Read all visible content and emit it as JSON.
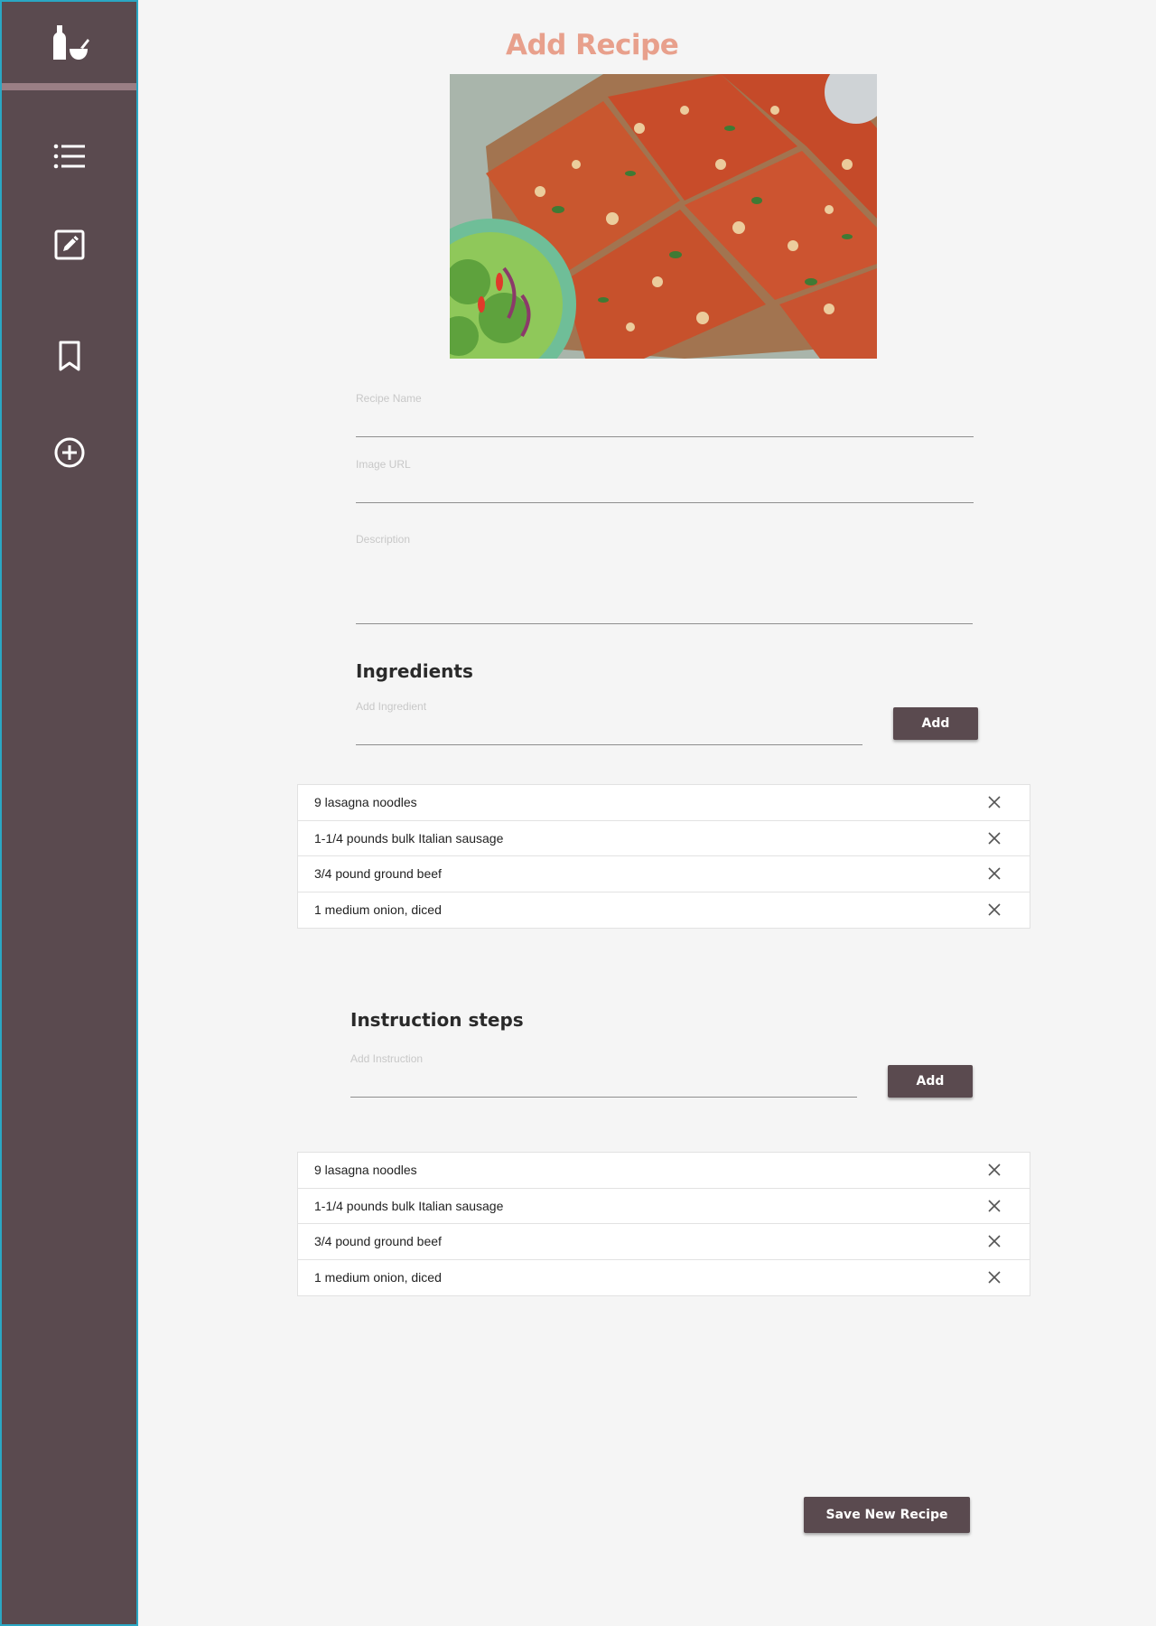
{
  "page": {
    "title": "Add Recipe"
  },
  "sidebar": {
    "logo_icon": "pestle-and-bottle-icon",
    "items": [
      {
        "name": "recipe-list",
        "icon": "list-icon"
      },
      {
        "name": "edit-recipe",
        "icon": "edit-icon"
      },
      {
        "name": "bookmarks",
        "icon": "bookmark-icon"
      },
      {
        "name": "add-recipe",
        "icon": "plus-circle-icon"
      }
    ],
    "colors": {
      "background": "#5a4a4f",
      "accent_bar": "#9a7f85",
      "border": "#2aa7c4"
    }
  },
  "form": {
    "recipe_name_label": "Recipe Name",
    "recipe_name_value": "",
    "image_url_label": "Image URL",
    "image_url_value": "",
    "description_label": "Description",
    "description_value": ""
  },
  "ingredients": {
    "heading": "Ingredients",
    "input_label": "Add Ingredient",
    "add_label": "Add",
    "items": [
      "9 lasagna noodles",
      "1-1/4 pounds bulk Italian sausage",
      "3/4 pound ground beef",
      "1 medium onion, diced"
    ]
  },
  "instructions": {
    "heading": "Instruction steps",
    "input_label": "Add Instruction",
    "add_label": "Add",
    "items": [
      "9 lasagna noodles",
      "1-1/4 pounds bulk Italian sausage",
      "3/4 pound ground beef",
      "1 medium onion, diced"
    ]
  },
  "footer": {
    "save_label": "Save New Recipe"
  },
  "theme": {
    "title_color": "#e8a08c",
    "button_color": "#5a4a4f"
  }
}
